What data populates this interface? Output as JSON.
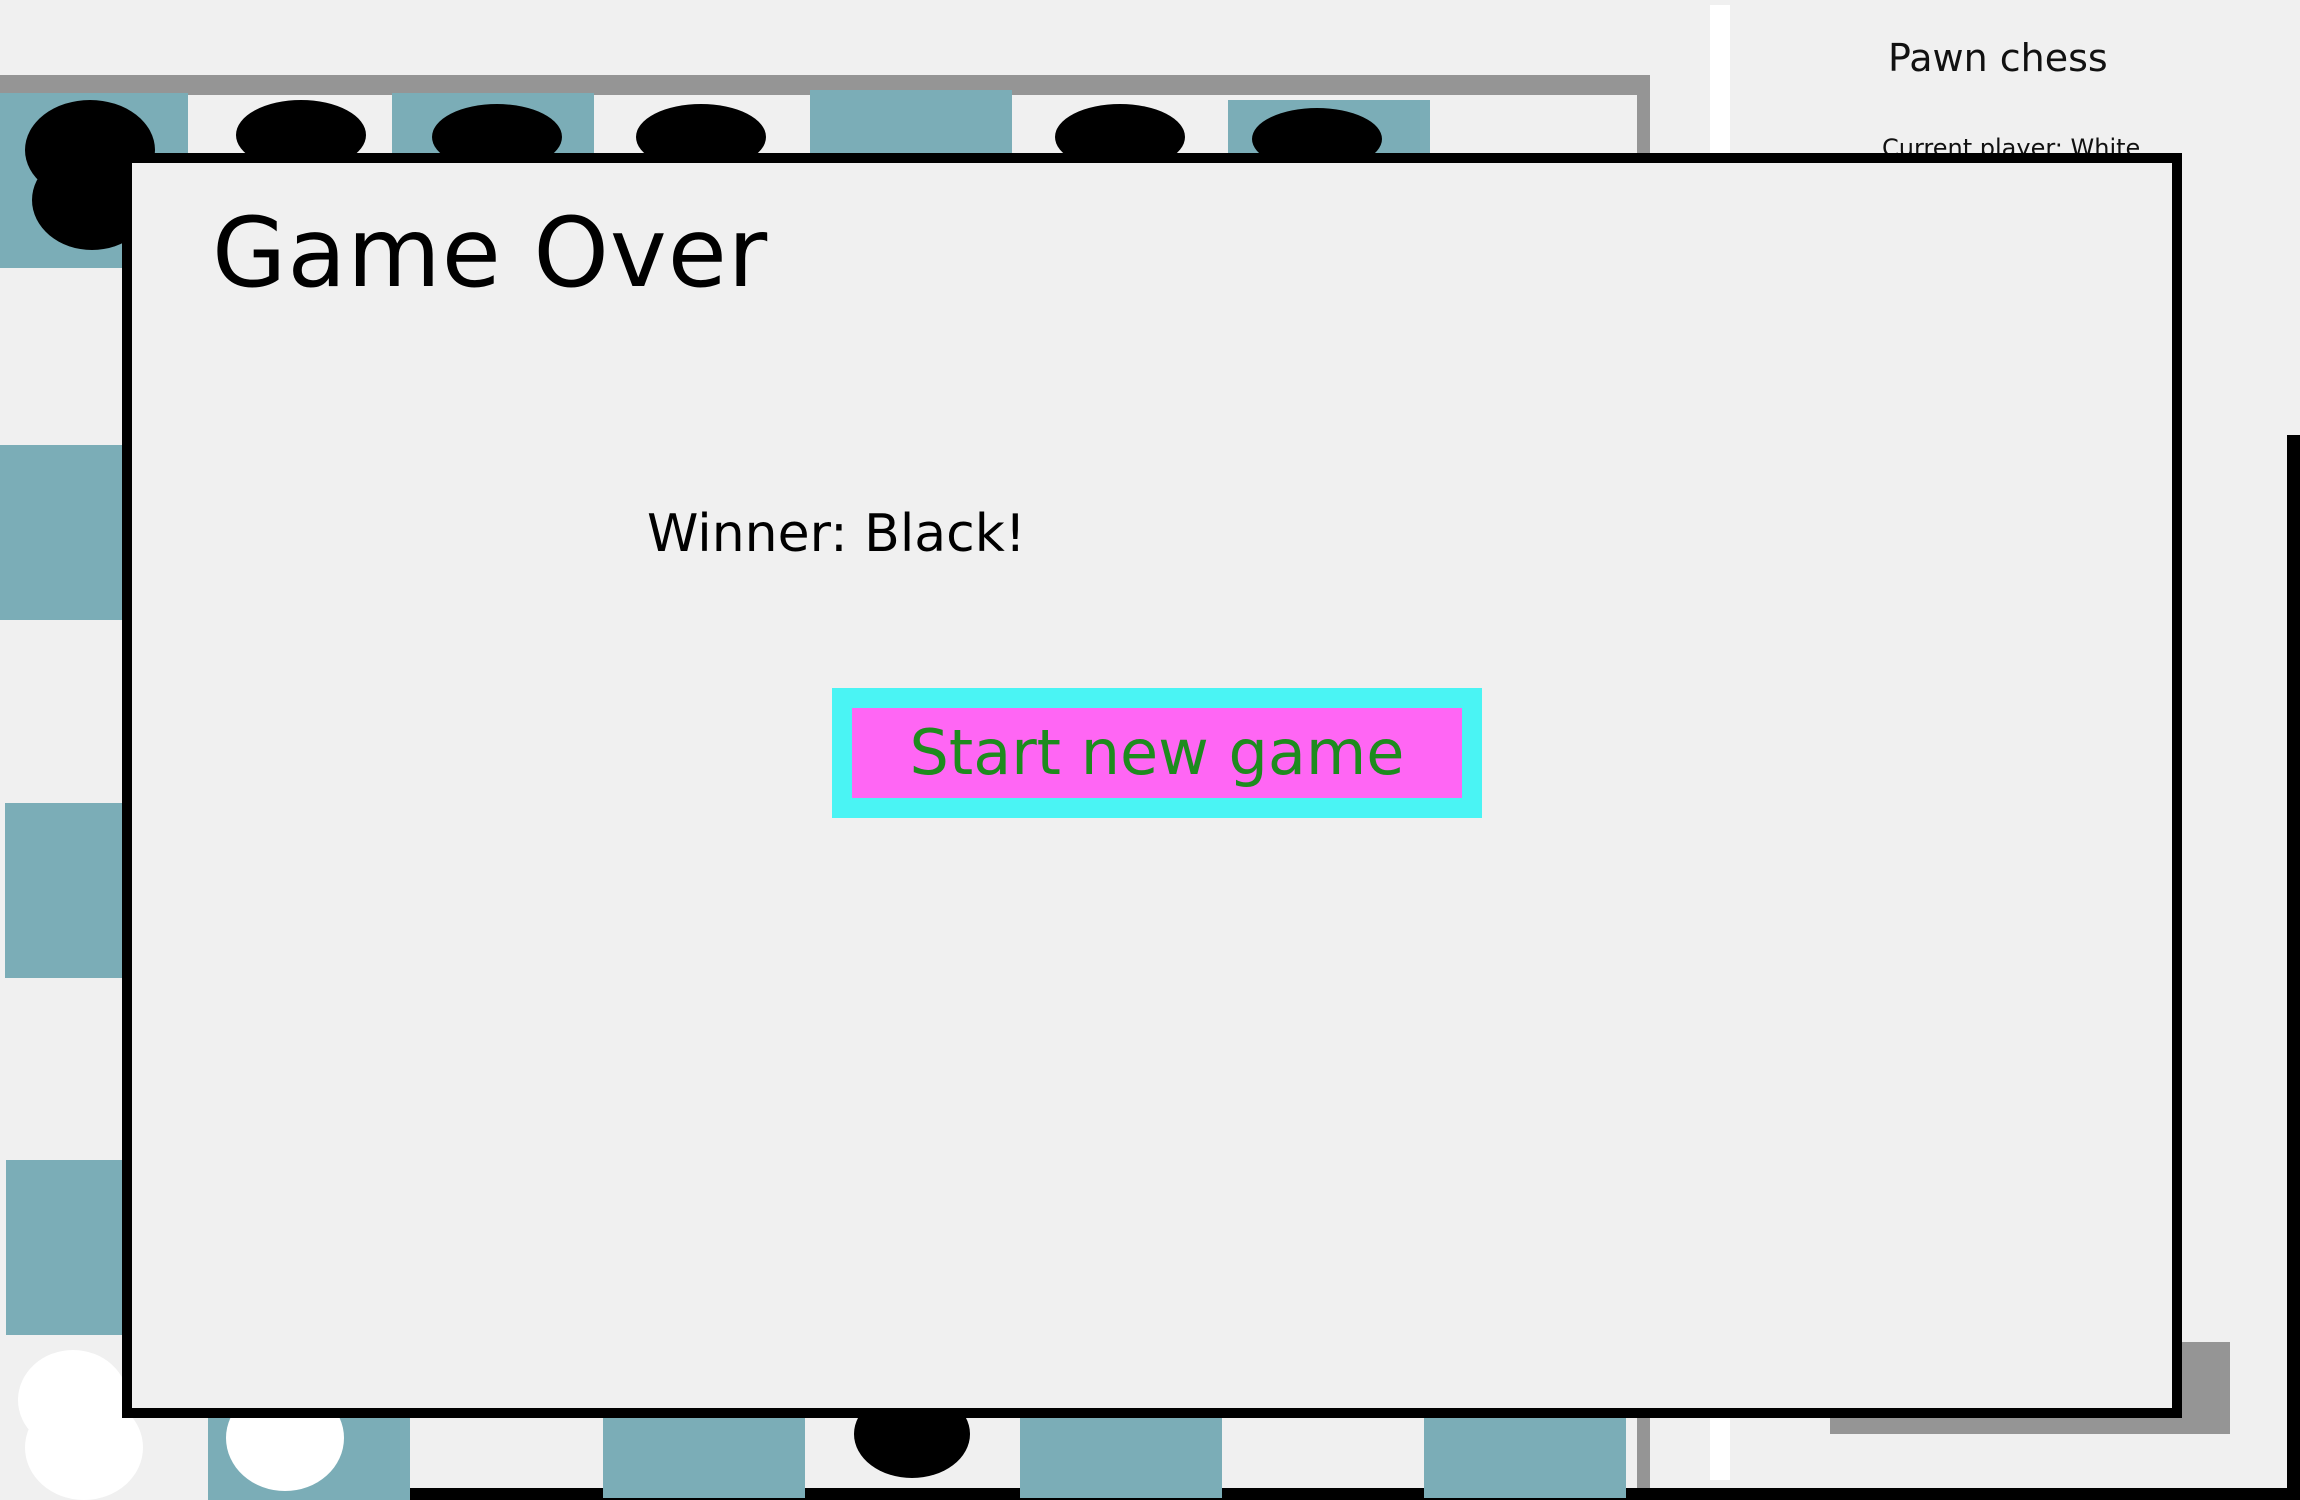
{
  "app": {
    "title": "Pawn chess"
  },
  "side_panel": {
    "title": "Pawn chess",
    "current_player_text": "Current player: White"
  },
  "modal": {
    "title": "Game Over",
    "winner_text": "Winner: Black!",
    "start_button_label": "Start new game"
  },
  "board": {
    "light_square_color": "#f0f0f0",
    "dark_square_color": "#7badb7",
    "frame_color": "#959595",
    "pieces": {
      "black": "#000000",
      "white": "#ffffff"
    }
  },
  "colors": {
    "button_fill": "#ff66f4",
    "button_border": "#4af4f4",
    "button_text": "#1e8b1e",
    "modal_border": "#000000",
    "background": "#f0f0f0"
  }
}
